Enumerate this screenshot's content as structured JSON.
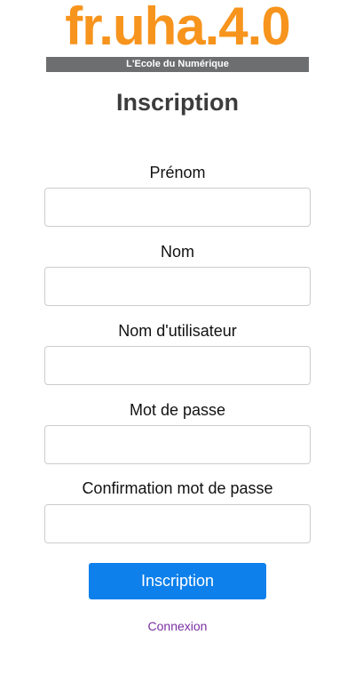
{
  "logo": {
    "main_text": "fr.uha.4.0",
    "tagline": "L'Ecole du Numérique",
    "colors": {
      "main": "#f7941d",
      "bar": "#6d6e70"
    }
  },
  "form": {
    "title": "Inscription",
    "fields": [
      {
        "label": "Prénom",
        "value": "",
        "placeholder": ""
      },
      {
        "label": "Nom",
        "value": "",
        "placeholder": ""
      },
      {
        "label": "Nom d'utilisateur",
        "value": "",
        "placeholder": ""
      },
      {
        "label": "Mot de passe",
        "value": "",
        "placeholder": ""
      },
      {
        "label": "Confirmation mot de passe",
        "value": "",
        "placeholder": ""
      }
    ],
    "submit_label": "Inscription",
    "login_link_label": "Connexion"
  },
  "colors": {
    "button": "#0d80ec",
    "link": "#7a2fa3",
    "title": "#3c3c3c"
  }
}
